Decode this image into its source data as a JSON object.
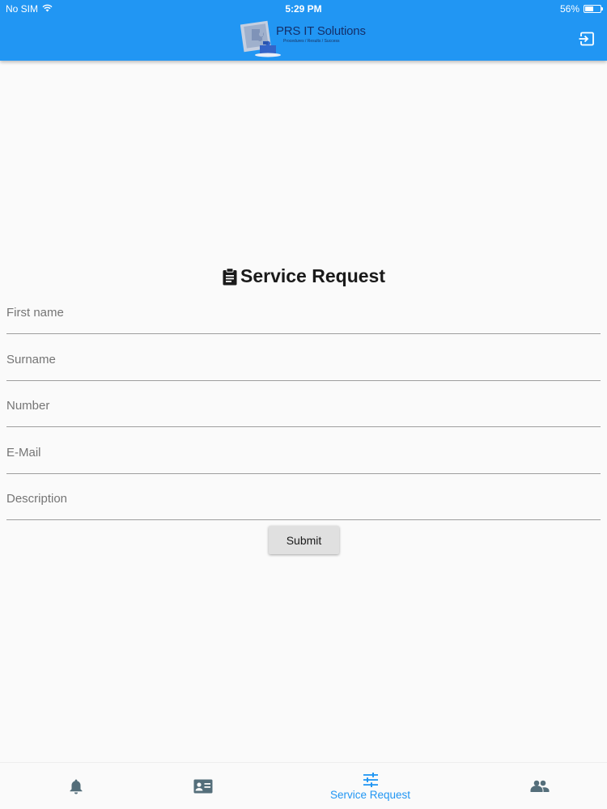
{
  "status_bar": {
    "carrier": "No SIM",
    "time": "5:29 PM",
    "battery_percent": "56%",
    "battery_level": 0.56
  },
  "header": {
    "logo_name": "PRS IT Solutions",
    "logo_tagline": "Procedures / Results / Success",
    "exit_icon": "exit-to-app-icon",
    "color": "#2196f3"
  },
  "form": {
    "title": "Service Request",
    "title_icon": "clipboard-icon",
    "fields": {
      "first_name": {
        "placeholder": "First name",
        "value": ""
      },
      "surname": {
        "placeholder": "Surname",
        "value": ""
      },
      "number": {
        "placeholder": "Number",
        "value": ""
      },
      "email": {
        "placeholder": "E-Mail",
        "value": ""
      },
      "description": {
        "placeholder": "Description",
        "value": ""
      }
    },
    "submit_label": "Submit"
  },
  "bottom_nav": {
    "active_color": "#2196f3",
    "inactive_color": "#546e7a",
    "items": [
      {
        "icon": "bell-icon",
        "label": ""
      },
      {
        "icon": "contact-card-icon",
        "label": ""
      },
      {
        "icon": "tune-sliders-icon",
        "label": "Service Request",
        "active": true
      },
      {
        "icon": "people-icon",
        "label": ""
      }
    ]
  }
}
